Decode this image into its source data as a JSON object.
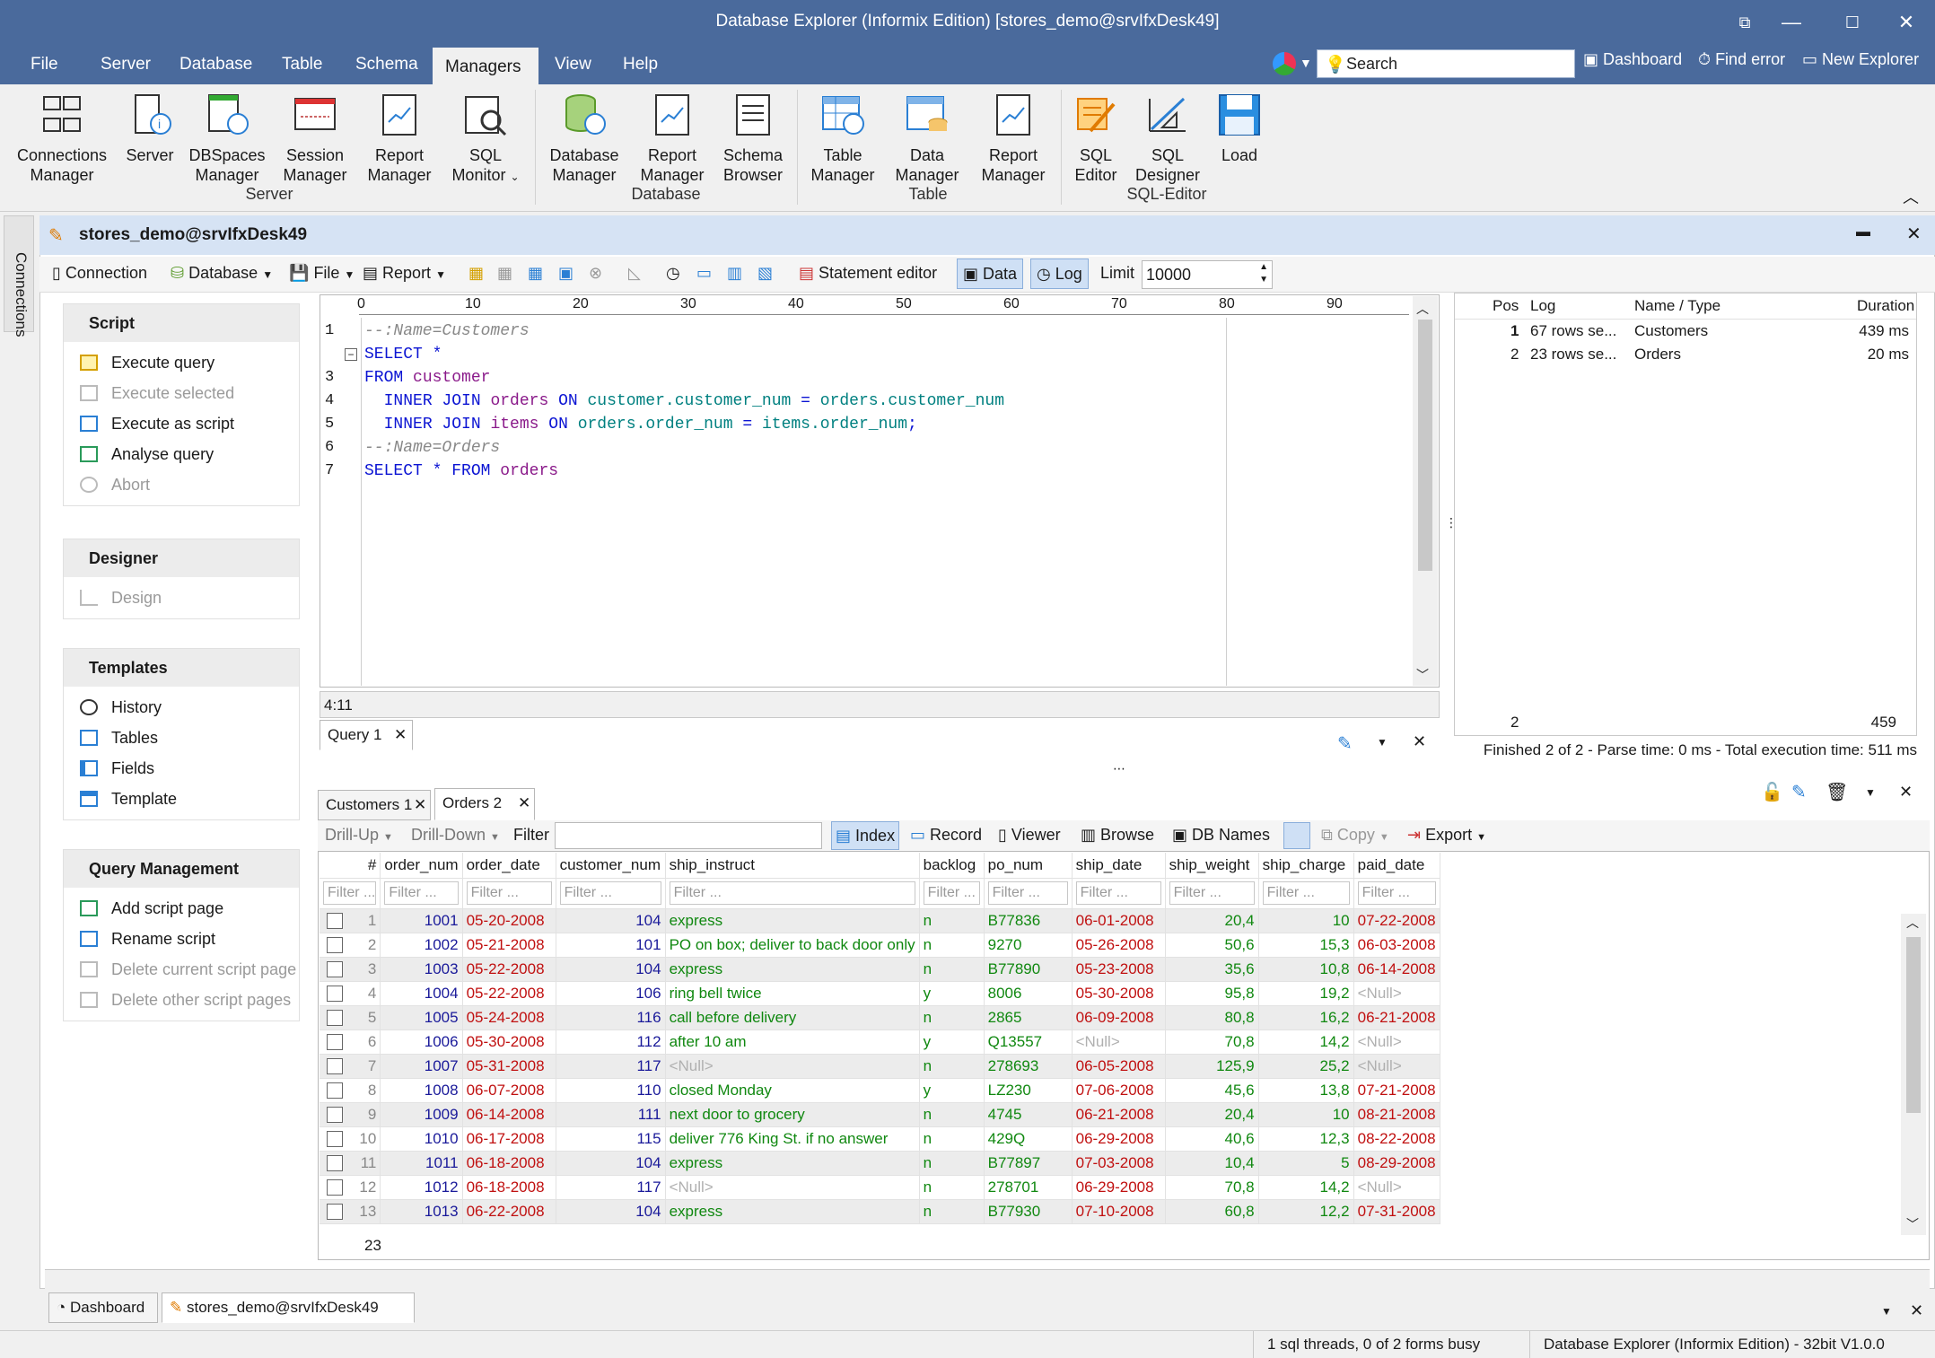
{
  "window": {
    "title": "Database Explorer (Informix Edition) [stores_demo@srvIfxDesk49]"
  },
  "menu": [
    "File",
    "Server",
    "Database",
    "Table",
    "Schema",
    "Managers",
    "View",
    "Help"
  ],
  "search": {
    "placeholder": "Search"
  },
  "top_actions": [
    "Dashboard",
    "Find error",
    "New Explorer"
  ],
  "ribbon": {
    "buttons": [
      {
        "l1": "Connections",
        "l2": "Manager"
      },
      {
        "l1": "Server",
        "l2": ""
      },
      {
        "l1": "DBSpaces",
        "l2": "Manager"
      },
      {
        "l1": "Session",
        "l2": "Manager"
      },
      {
        "l1": "Report",
        "l2": "Manager"
      },
      {
        "l1": "SQL",
        "l2": "Monitor"
      },
      {
        "l1": "Database",
        "l2": "Manager"
      },
      {
        "l1": "Report",
        "l2": "Manager"
      },
      {
        "l1": "Schema",
        "l2": "Browser"
      },
      {
        "l1": "Table",
        "l2": "Manager"
      },
      {
        "l1": "Data",
        "l2": "Manager"
      },
      {
        "l1": "Report",
        "l2": "Manager"
      },
      {
        "l1": "SQL",
        "l2": "Editor"
      },
      {
        "l1": "SQL",
        "l2": "Designer"
      },
      {
        "l1": "Load",
        "l2": ""
      }
    ],
    "groups": [
      "Server",
      "Database",
      "Table",
      "SQL-Editor"
    ]
  },
  "left_tab": "Connections",
  "doc_title": "stores_demo@srvIfxDesk49",
  "toolbar": {
    "connection": "Connection",
    "database": "Database",
    "file": "File",
    "report": "Report",
    "statement_editor": "Statement editor",
    "data": "Data",
    "log": "Log",
    "limit_label": "Limit",
    "limit_value": "10000"
  },
  "sidebar": {
    "script": {
      "title": "Script",
      "items": [
        "Execute query",
        "Execute selected",
        "Execute as script",
        "Analyse query",
        "Abort"
      ]
    },
    "designer": {
      "title": "Designer",
      "items": [
        "Design"
      ]
    },
    "templates": {
      "title": "Templates",
      "items": [
        "History",
        "Tables",
        "Fields",
        "Template"
      ]
    },
    "qm": {
      "title": "Query Management",
      "items": [
        "Add script page",
        "Rename script",
        "Delete current script page",
        "Delete other script pages"
      ]
    }
  },
  "editor": {
    "ruler": [
      "0",
      "10",
      "20",
      "30",
      "40",
      "50",
      "60",
      "70",
      "80",
      "90"
    ],
    "line_numbers": [
      "1",
      "",
      "3",
      "4",
      "5",
      "6",
      "7"
    ],
    "cursor": "4:11",
    "query_tab": "Query 1"
  },
  "log": {
    "headers": [
      "Pos",
      "Log",
      "Name / Type",
      "Duration"
    ],
    "rows": [
      {
        "pos": "1",
        "log": "67 rows se...",
        "name": "Customers",
        "dur": "439 ms"
      },
      {
        "pos": "2",
        "log": "23 rows se...",
        "name": "Orders",
        "dur": "20 ms"
      }
    ],
    "footer_pos": "2",
    "footer_dur": "459",
    "finished": "Finished 2 of 2 - Parse time: 0 ms - Total execution time: 511 ms"
  },
  "result_tabs": [
    "Customers 1",
    "Orders 2"
  ],
  "result_toolbar": {
    "drillup": "Drill-Up",
    "drilldown": "Drill-Down",
    "filter": "Filter",
    "index": "Index",
    "record": "Record",
    "viewer": "Viewer",
    "browse": "Browse",
    "dbnames": "DB Names",
    "copy": "Copy",
    "export": "Export"
  },
  "grid": {
    "columns": [
      "#",
      "order_num",
      "order_date",
      "customer_num",
      "ship_instruct",
      "backlog",
      "po_num",
      "ship_date",
      "ship_weight",
      "ship_charge",
      "paid_date"
    ],
    "filter_placeholder": "Filter ...",
    "rows": [
      [
        "1",
        "1001",
        "05-20-2008",
        "104",
        "express",
        "n",
        "B77836",
        "06-01-2008",
        "20,4",
        "10",
        "07-22-2008"
      ],
      [
        "2",
        "1002",
        "05-21-2008",
        "101",
        "PO on box; deliver to back door only",
        "n",
        "9270",
        "05-26-2008",
        "50,6",
        "15,3",
        "06-03-2008"
      ],
      [
        "3",
        "1003",
        "05-22-2008",
        "104",
        "express",
        "n",
        "B77890",
        "05-23-2008",
        "35,6",
        "10,8",
        "06-14-2008"
      ],
      [
        "4",
        "1004",
        "05-22-2008",
        "106",
        "ring bell twice",
        "y",
        "8006",
        "05-30-2008",
        "95,8",
        "19,2",
        "<Null>"
      ],
      [
        "5",
        "1005",
        "05-24-2008",
        "116",
        "call before delivery",
        "n",
        "2865",
        "06-09-2008",
        "80,8",
        "16,2",
        "06-21-2008"
      ],
      [
        "6",
        "1006",
        "05-30-2008",
        "112",
        "after 10 am",
        "y",
        "Q13557",
        "<Null>",
        "70,8",
        "14,2",
        "<Null>"
      ],
      [
        "7",
        "1007",
        "05-31-2008",
        "117",
        "<Null>",
        "n",
        "278693",
        "06-05-2008",
        "125,9",
        "25,2",
        "<Null>"
      ],
      [
        "8",
        "1008",
        "06-07-2008",
        "110",
        "closed Monday",
        "y",
        "LZ230",
        "07-06-2008",
        "45,6",
        "13,8",
        "07-21-2008"
      ],
      [
        "9",
        "1009",
        "06-14-2008",
        "111",
        "next door to grocery",
        "n",
        "4745",
        "06-21-2008",
        "20,4",
        "10",
        "08-21-2008"
      ],
      [
        "10",
        "1010",
        "06-17-2008",
        "115",
        "deliver 776 King St. if no answer",
        "n",
        "429Q",
        "06-29-2008",
        "40,6",
        "12,3",
        "08-22-2008"
      ],
      [
        "11",
        "1011",
        "06-18-2008",
        "104",
        "express",
        "n",
        "B77897",
        "07-03-2008",
        "10,4",
        "5",
        "08-29-2008"
      ],
      [
        "12",
        "1012",
        "06-18-2008",
        "117",
        "<Null>",
        "n",
        "278701",
        "06-29-2008",
        "70,8",
        "14,2",
        "<Null>"
      ],
      [
        "13",
        "1013",
        "06-22-2008",
        "104",
        "express",
        "n",
        "B77930",
        "07-10-2008",
        "60,8",
        "12,2",
        "07-31-2008"
      ]
    ],
    "count": "23"
  },
  "bottom_tabs": [
    "Dashboard",
    "stores_demo@srvIfxDesk49"
  ],
  "status": {
    "threads": "1 sql threads, 0 of 2 forms busy",
    "app": "Database Explorer (Informix Edition) - 32bit V1.0.0"
  }
}
